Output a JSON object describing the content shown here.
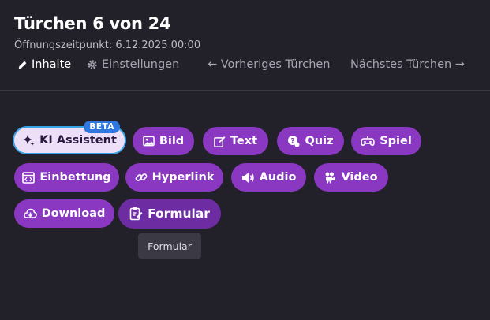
{
  "header": {
    "title": "Türchen 6 von 24",
    "subtitle": "Öffnungszeitpunkt: 6.12.2025 00:00"
  },
  "tabs": [
    {
      "label": "Inhalte",
      "icon": "pencil-icon",
      "active": true
    },
    {
      "label": "Einstellungen",
      "icon": "gear-icon",
      "active": false
    },
    {
      "label": "← Vorheriges Türchen",
      "active": false
    },
    {
      "label": "Nächstes Türchen →",
      "active": false
    }
  ],
  "content_buttons": {
    "ki": {
      "label": "KI Assistent",
      "badge": "BETA",
      "icon": "sparkles-icon"
    },
    "bild": {
      "label": "Bild",
      "icon": "image-icon"
    },
    "text": {
      "label": "Text",
      "icon": "edit-icon"
    },
    "quiz": {
      "label": "Quiz",
      "icon": "quiz-icon"
    },
    "spiel": {
      "label": "Spiel",
      "icon": "gamepad-icon"
    },
    "einbettung": {
      "label": "Einbettung",
      "icon": "embed-icon"
    },
    "hyperlink": {
      "label": "Hyperlink",
      "icon": "link-icon"
    },
    "audio": {
      "label": "Audio",
      "icon": "speaker-icon"
    },
    "video": {
      "label": "Video",
      "icon": "video-camera-icon"
    },
    "download": {
      "label": "Download",
      "icon": "cloud-download-icon"
    },
    "formular": {
      "label": "Formular",
      "icon": "clipboard-icon"
    }
  },
  "tooltip": "Formular",
  "colors": {
    "background": "#222029",
    "button": "#8a38c2",
    "button_hover": "#6e2ca3",
    "ki_button": "#ecdff7",
    "ki_border": "#37a2e6",
    "beta_badge": "#2d77de",
    "tooltip": "#3b3944"
  }
}
